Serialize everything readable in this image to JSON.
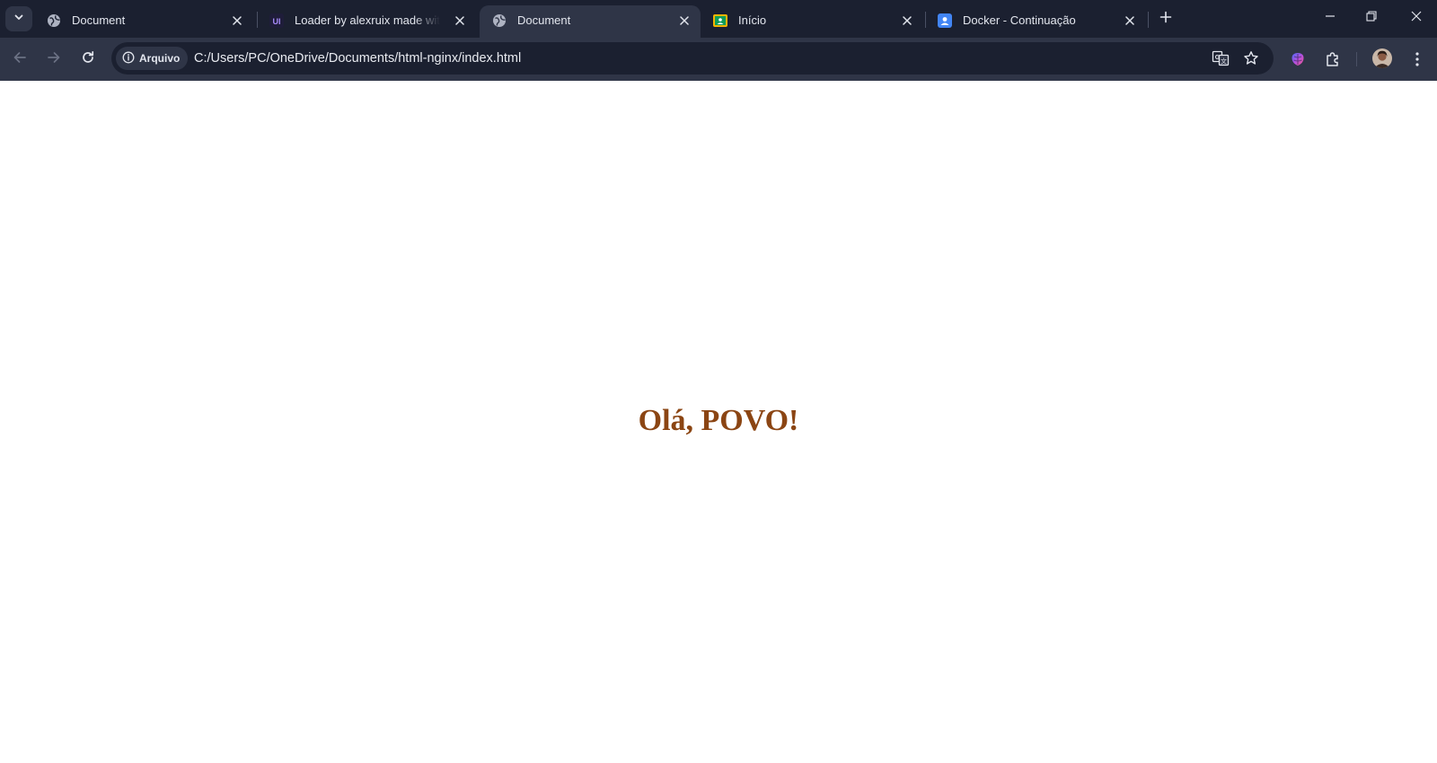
{
  "browser": {
    "tabs": [
      {
        "title": "Document",
        "favicon": "globe-icon",
        "active": false
      },
      {
        "title": "Loader by alexruix made with CSS",
        "favicon": "uiverse-icon",
        "active": false
      },
      {
        "title": "Document",
        "favicon": "globe-icon",
        "active": true
      },
      {
        "title": "Início",
        "favicon": "google-classroom-icon",
        "active": false
      },
      {
        "title": "Docker - Continuação",
        "favicon": "profile-card-icon",
        "active": false
      }
    ],
    "address_bar": {
      "security_chip": "Arquivo",
      "url": "C:/Users/PC/OneDrive/Documents/html-nginx/index.html"
    }
  },
  "page": {
    "heading": "Olá, POVO!",
    "heading_color": "#8b4513"
  },
  "colors": {
    "tabstrip": "#1b2030",
    "toolbar": "#2f3547",
    "text": "#e3e6ee"
  }
}
